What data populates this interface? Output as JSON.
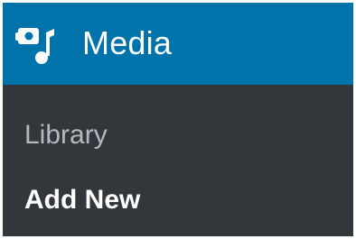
{
  "menu": {
    "title": "Media",
    "icon": "media-icon",
    "accent_color": "#0073aa",
    "submenu_background": "#32373c",
    "items": [
      {
        "label": "Library",
        "current": false,
        "color": "#b4b9be"
      },
      {
        "label": "Add New",
        "current": true,
        "color": "#ffffff"
      }
    ]
  }
}
